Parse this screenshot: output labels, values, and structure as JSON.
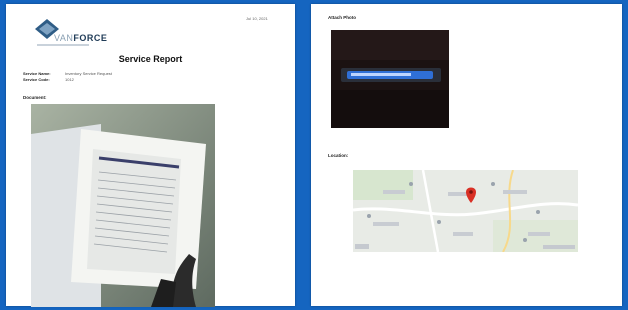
{
  "page1": {
    "brand_left": "VAN",
    "brand_right": "FORCE",
    "date": "Jul 10, 2021",
    "title": "Service Report",
    "meta": [
      {
        "key": "Service Name:",
        "value": "Inventory Service Request"
      },
      {
        "key": "Service Code:",
        "value": "1012"
      }
    ],
    "section_label": "Document:"
  },
  "page2": {
    "section_photo_label": "Attach Photo",
    "section_location_label": "Location:"
  },
  "colors": {
    "background": "#1565c0",
    "page": "#ffffff",
    "map_pin": "#d93025"
  },
  "icons": [
    "logo-mark",
    "map-pin-icon"
  ]
}
